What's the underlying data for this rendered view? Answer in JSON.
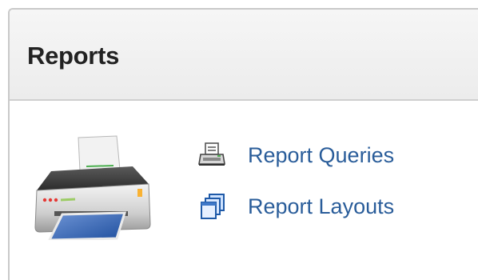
{
  "panel": {
    "title": "Reports"
  },
  "links": [
    {
      "label": "Report Queries",
      "icon": "print-icon"
    },
    {
      "label": "Report Layouts",
      "icon": "layouts-icon"
    }
  ],
  "illustration": {
    "icon": "printer-icon"
  },
  "colors": {
    "link": "#2a5d9a",
    "title": "#222222",
    "header_bg": "#eeeeee",
    "border": "#c9c9c9"
  }
}
